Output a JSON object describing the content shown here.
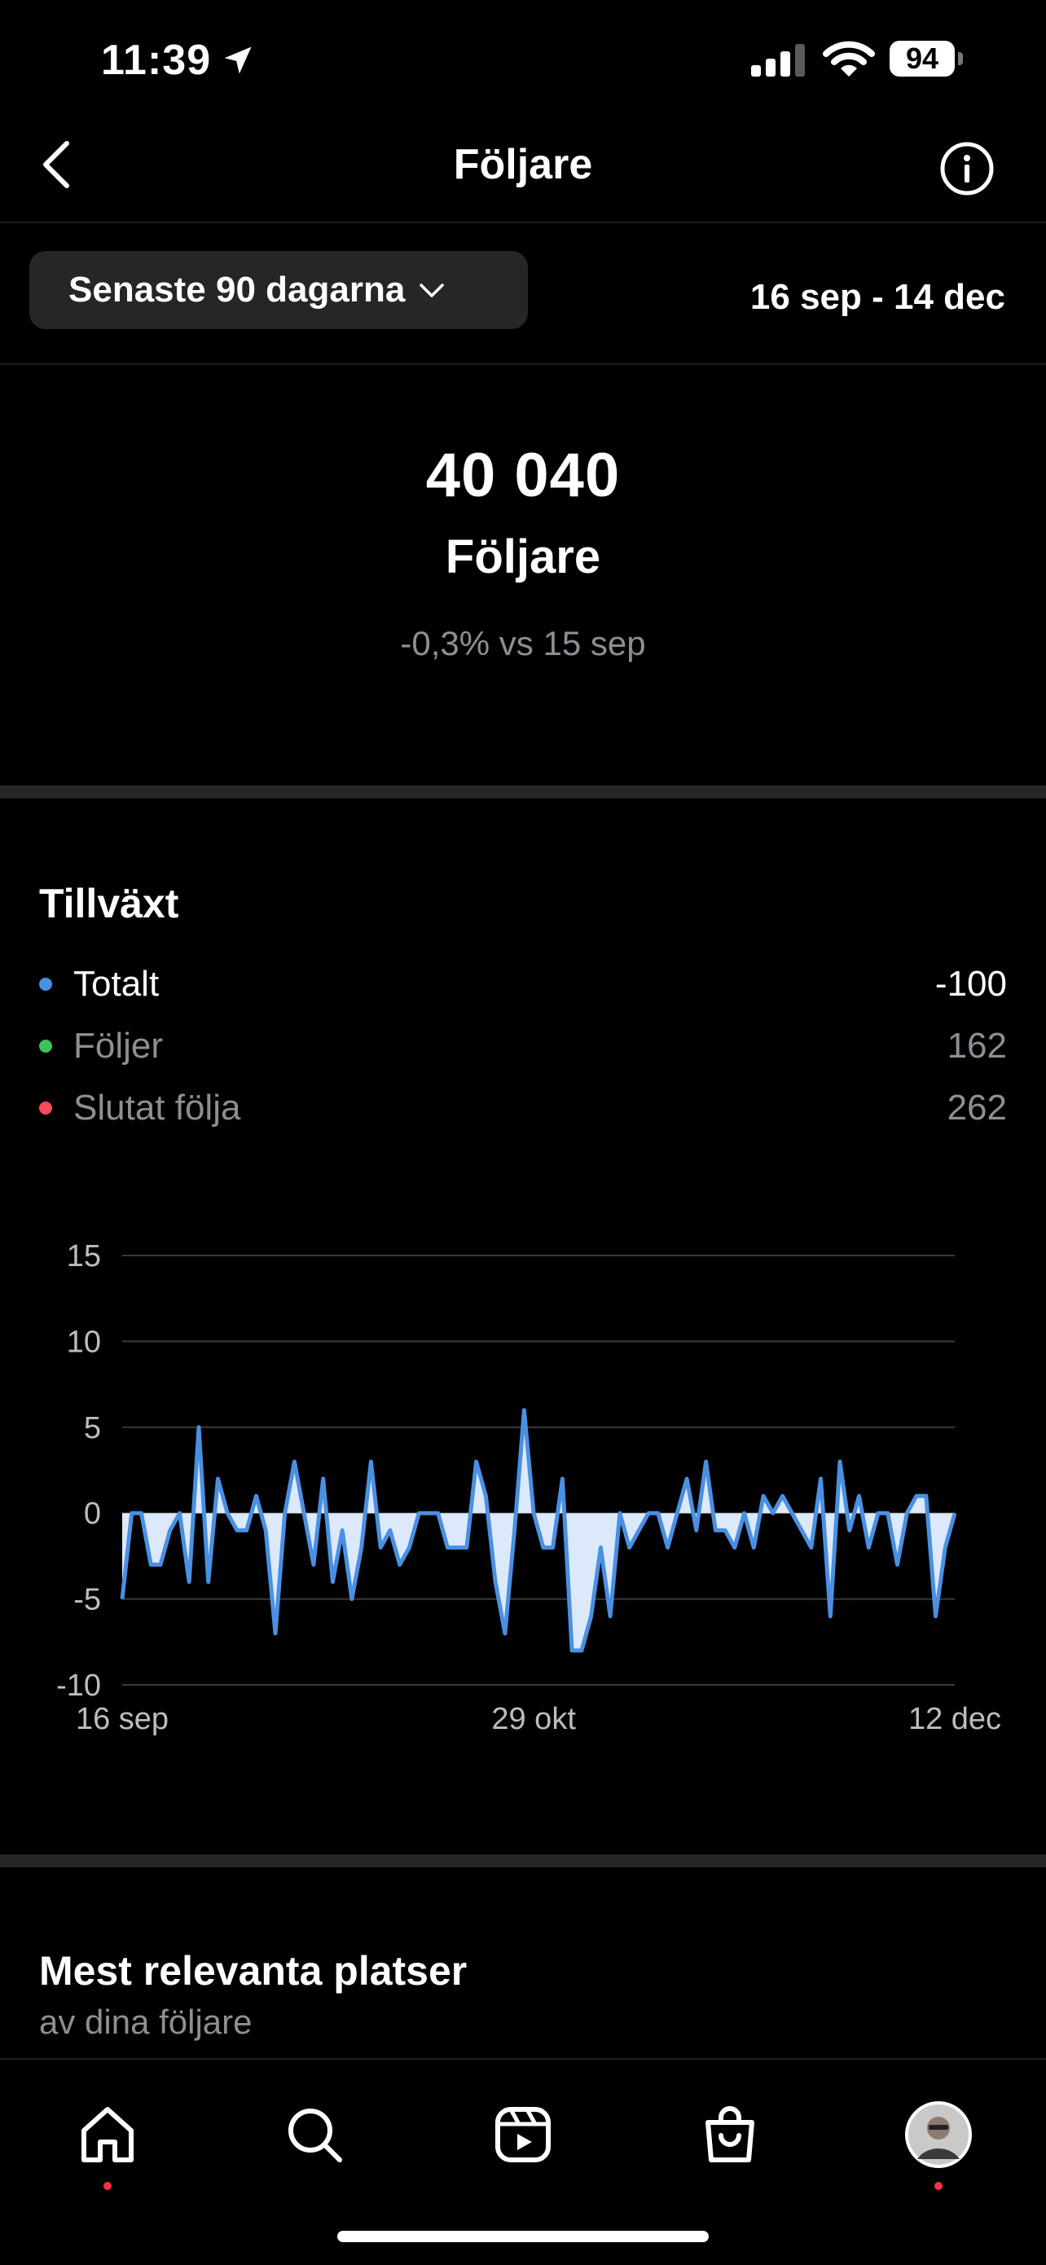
{
  "status_bar": {
    "time": "11:39",
    "battery": "94"
  },
  "header": {
    "title": "Följare"
  },
  "filter": {
    "range_label": "Senaste 90 dagarna",
    "date_range": "16 sep - 14 dec"
  },
  "summary": {
    "count": "40 040",
    "label": "Följare",
    "comparison": "-0,3% vs 15 sep"
  },
  "growth": {
    "title": "Tillväxt",
    "legend": [
      {
        "name": "Totalt",
        "value": "-100",
        "color": "#4a90e2"
      },
      {
        "name": "Följer",
        "value": "162",
        "color": "#3ac35a"
      },
      {
        "name": "Slutat följa",
        "value": "262",
        "color": "#ff4a5a"
      }
    ]
  },
  "locations": {
    "title": "Mest relevanta platser",
    "subtitle": "av dina följare"
  },
  "tabbar": {
    "items": [
      {
        "name": "home-icon",
        "notification": true
      },
      {
        "name": "search-icon",
        "notification": false
      },
      {
        "name": "reels-icon",
        "notification": false
      },
      {
        "name": "shop-icon",
        "notification": false
      },
      {
        "name": "profile-avatar",
        "notification": true
      }
    ]
  },
  "colors": {
    "accent": "#4a90e2",
    "fill": "#dbe9fb"
  },
  "chart_data": {
    "type": "area",
    "x_start": "16 sep",
    "x_tick_labels": [
      "16 sep",
      "29 okt",
      "12 dec"
    ],
    "x_tick_index": [
      0,
      43,
      87
    ],
    "ylim": [
      -10,
      15
    ],
    "yticks": [
      15,
      10,
      5,
      0,
      -5,
      -10
    ],
    "grid": true,
    "series": [
      {
        "values": [
          -5,
          0,
          0,
          -3,
          -3,
          -1,
          0,
          -4,
          5,
          -4,
          2,
          0,
          -1,
          -1,
          1,
          -1,
          -7,
          0,
          3,
          0,
          -3,
          2,
          -4,
          -1,
          -5,
          -2,
          3,
          -2,
          -1,
          -3,
          -2,
          0,
          0,
          0,
          -2,
          -2,
          -2,
          3,
          1,
          -4,
          -7,
          -1,
          6,
          0,
          -2,
          -2,
          2,
          -8,
          -8,
          -6,
          -2,
          -6,
          0,
          -2,
          -1,
          0,
          0,
          -2,
          0,
          2,
          -1,
          3,
          -1,
          -1,
          -2,
          0,
          -2,
          1,
          0,
          1,
          0,
          -1,
          -2,
          2,
          -6,
          3,
          -1,
          1,
          -2,
          0,
          0,
          -3,
          0,
          1,
          1,
          -6,
          -2,
          0
        ]
      }
    ]
  }
}
